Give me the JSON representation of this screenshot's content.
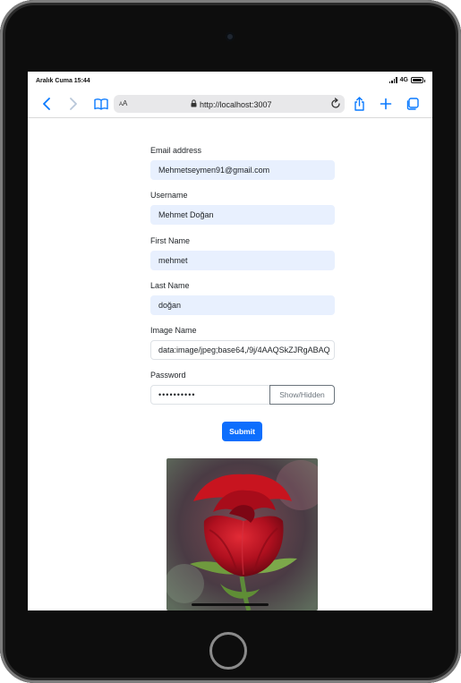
{
  "status": {
    "time": "Aralık Cuma 15:44",
    "network": "4G"
  },
  "browser": {
    "text_size_label": "AA",
    "url": "http://localhost:3007"
  },
  "form": {
    "email": {
      "label": "Email address",
      "value": "Mehmetseymen91@gmail.com"
    },
    "username": {
      "label": "Username",
      "value": "Mehmet Doğan"
    },
    "first_name": {
      "label": "First Name",
      "value": "mehmet"
    },
    "last_name": {
      "label": "Last Name",
      "value": "doğan"
    },
    "image_name": {
      "label": "Image Name",
      "value": "data:image/jpeg;base64,/9j/4AAQSkZJRgABAQ"
    },
    "password": {
      "label": "Password",
      "value": "••••••••••",
      "toggle_label": "Show/Hidden"
    },
    "submit_label": "Submit"
  },
  "colors": {
    "primary": "#0d6efd",
    "autofill": "#e8f0fe",
    "browser_accent": "#0a7aff",
    "frame": "#0d0d0d"
  },
  "icons": [
    "back-icon",
    "forward-icon",
    "bookmarks-icon",
    "lock-icon",
    "reload-icon",
    "share-icon",
    "new-tab-icon",
    "tabs-icon"
  ]
}
